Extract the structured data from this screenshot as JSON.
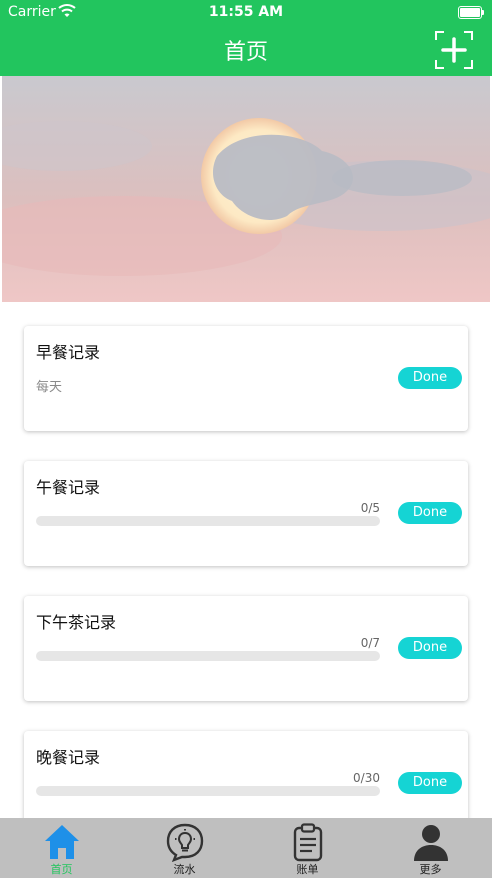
{
  "status_bar": {
    "carrier": "Carrier",
    "time": "11:55 AM"
  },
  "nav": {
    "title": "首页"
  },
  "cards": [
    {
      "title": "早餐记录",
      "subtitle": "每天",
      "button": "Done"
    },
    {
      "title": "午餐记录",
      "progress_text": "0/5",
      "progress": 0,
      "button": "Done"
    },
    {
      "title": "下午茶记录",
      "progress_text": "0/7",
      "progress": 0,
      "button": "Done"
    },
    {
      "title": "晚餐记录",
      "progress_text": "0/30",
      "progress": 0,
      "button": "Done"
    }
  ],
  "tabs": [
    {
      "label": "首页",
      "icon": "home-icon",
      "active": true
    },
    {
      "label": "流水",
      "icon": "lightbulb-chat-icon",
      "active": false
    },
    {
      "label": "账单",
      "icon": "clipboard-icon",
      "active": false
    },
    {
      "label": "更多",
      "icon": "person-icon",
      "active": false
    }
  ],
  "colors": {
    "accent": "#22c55e",
    "done_button": "#15d4d4",
    "tab_bar": "#bfbfbf"
  }
}
